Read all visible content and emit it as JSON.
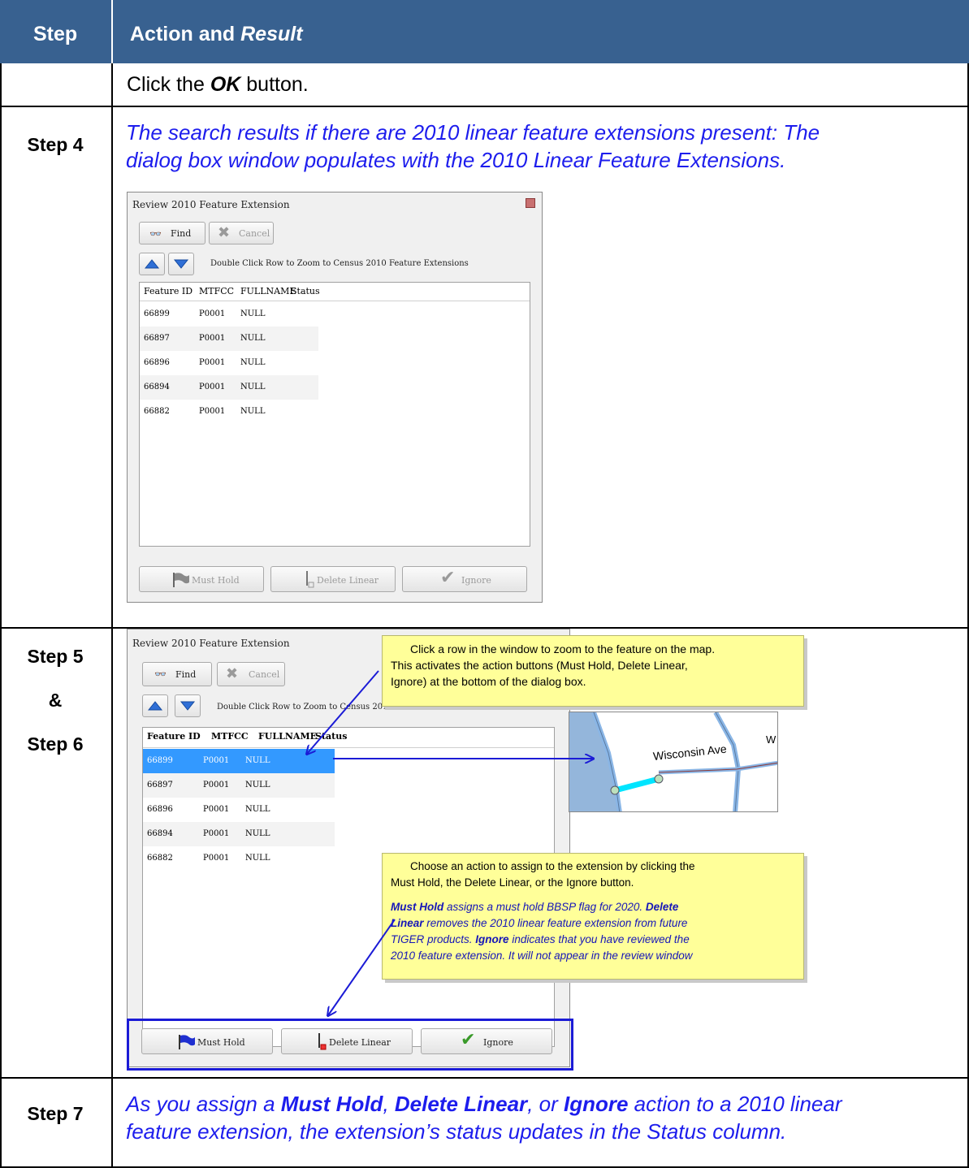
{
  "header": {
    "step": "Step",
    "action_plain": "Action and ",
    "action_italic": "Result"
  },
  "row1": {
    "text_prefix": "Click the ",
    "ok": "OK",
    "text_suffix": " button."
  },
  "row2": {
    "step": "Step 4",
    "text_line1": "The search results if there are 2010 linear feature extensions present: The",
    "text_line2": "dialog box window populates with the 2010 Linear Feature Extensions."
  },
  "dialog": {
    "title": "Review 2010 Feature Extension",
    "find": "Find",
    "cancel": "Cancel",
    "instruction": "Double Click Row to Zoom to Census 2010 Feature Extensions",
    "columns": [
      "Feature ID",
      "MTFCC",
      "FULLNAME",
      "Status"
    ],
    "rows": [
      {
        "id": "66899",
        "mtfcc": "P0001",
        "name": "NULL"
      },
      {
        "id": "66897",
        "mtfcc": "P0001",
        "name": "NULL"
      },
      {
        "id": "66896",
        "mtfcc": "P0001",
        "name": "NULL"
      },
      {
        "id": "66894",
        "mtfcc": "P0001",
        "name": "NULL"
      },
      {
        "id": "66882",
        "mtfcc": "P0001",
        "name": "NULL"
      }
    ],
    "must_hold": "Must Hold",
    "delete_linear": "Delete Linear",
    "ignore": "Ignore"
  },
  "row3": {
    "step_a": "Step 5",
    "amp": "&",
    "step_b": "Step 6",
    "dialog_instruction": "Double Click Row to Zoom to Census 2010 Feature Extensions"
  },
  "callout1": {
    "line1": "Click a row in the window to zoom to the feature on the map.",
    "line2": "This activates the action buttons (Must Hold, Delete Linear,",
    "line3": "Ignore) at the bottom of the dialog box."
  },
  "map": {
    "street1": "Wisconsin Ave",
    "street2": "W"
  },
  "callout2": {
    "line1": "Choose an action to assign to the extension by clicking the",
    "line2": "Must Hold, the Delete Linear, or the Ignore button.",
    "must_hold": "Must Hold",
    "t1": " assigns a must hold BBSP flag for 2020. ",
    "delete": "Delete",
    "linear": "Linear",
    "t2": " removes the 2010 linear feature extension from future",
    "t3": "TIGER products. ",
    "ignore": "Ignore",
    "t4": " indicates that you have reviewed the",
    "t5": "2010 feature extension. It will not appear in the review window"
  },
  "row4": {
    "step": "Step 7",
    "l1_a": "As you assign a ",
    "l1_b": "Must Hold",
    "l1_c": ", ",
    "l1_d": "Delete Linear",
    "l1_e": ", or ",
    "l1_f": "Ignore",
    "l1_g": " action to a 2010 linear",
    "line2": "feature extension, the extension’s status updates in the Status column."
  },
  "colors": {
    "header_bg": "#386190",
    "instruction_text": "#1d1ded",
    "selection": "#3399ff",
    "callout_bg": "#ffff99"
  }
}
